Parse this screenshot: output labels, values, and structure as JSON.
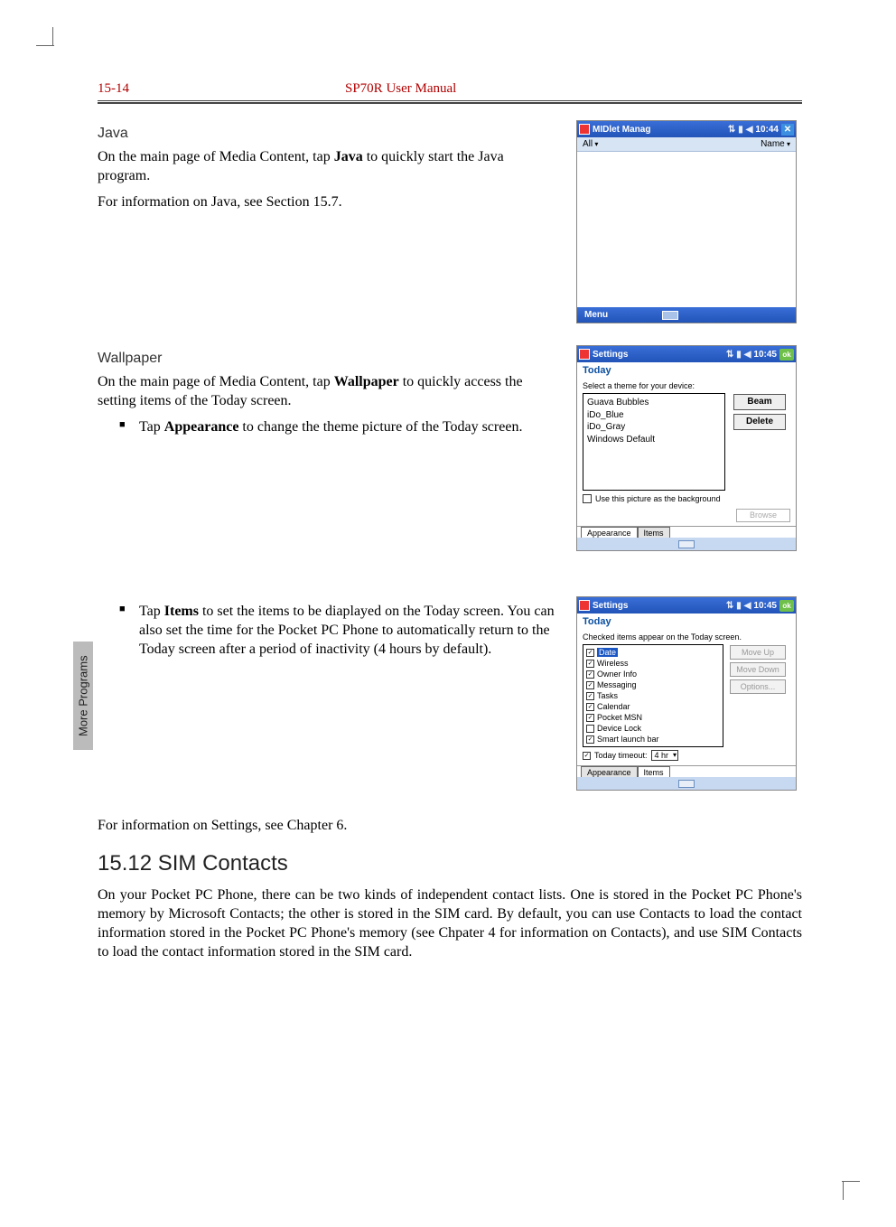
{
  "header": {
    "page_no": "15-14",
    "title": "SP70R User Manual"
  },
  "side_tab": "More Programs",
  "java": {
    "heading": "Java",
    "p1_a": "On the main page of Media Content, tap ",
    "p1_b": "Java",
    "p1_c": " to quickly start the Java program.",
    "p2": "For information on Java, see Section 15.7."
  },
  "wallpaper": {
    "heading": "Wallpaper",
    "p1_a": "On the main page of Media Content, tap ",
    "p1_b": "Wallpaper",
    "p1_c": " to quickly access the setting items of the Today screen.",
    "b1_a": "Tap ",
    "b1_b": "Appearance",
    "b1_c": " to change the theme picture of the Today screen.",
    "b2_a": "Tap ",
    "b2_b": "Items",
    "b2_c": " to set the items to be diaplayed on the Today screen. You can also set the time for the Pocket PC Phone to automatically return to the Today screen after a period of inactivity (4 hours by default).",
    "p2": "For information on Settings, see Chapter 6."
  },
  "sim": {
    "heading": "15.12  SIM Contacts",
    "p1": "On your Pocket PC Phone, there can be two kinds of independent contact lists. One is stored in the Pocket PC Phone's memory by Microsoft Contacts; the other is stored in the SIM card. By default, you can use Contacts to load the contact information stored in the Pocket PC Phone's memory (see Chpater 4 for information on Contacts), and use SIM Contacts to load the contact information stored in the SIM card."
  },
  "shot1": {
    "title": "MIDlet Manag",
    "time": "10:44",
    "all": "All",
    "name": "Name",
    "menu": "Menu"
  },
  "shot2": {
    "title": "Settings",
    "time": "10:45",
    "ok": "ok",
    "today": "Today",
    "hint": "Select a theme for your device:",
    "themes": [
      "Guava Bubbles",
      "iDo_Blue",
      "iDo_Gray",
      "Windows Default"
    ],
    "beam": "Beam",
    "delete": "Delete",
    "usebg": "Use this picture as the background",
    "browse": "Browse",
    "tab1": "Appearance",
    "tab2": "Items"
  },
  "shot3": {
    "title": "Settings",
    "time": "10:45",
    "ok": "ok",
    "today": "Today",
    "hint": "Checked items appear on the Today screen.",
    "items": [
      {
        "label": "Date",
        "checked": true,
        "hl": true
      },
      {
        "label": "Wireless",
        "checked": true
      },
      {
        "label": "Owner Info",
        "checked": true
      },
      {
        "label": "Messaging",
        "checked": true
      },
      {
        "label": "Tasks",
        "checked": true
      },
      {
        "label": "Calendar",
        "checked": true
      },
      {
        "label": "Pocket MSN",
        "checked": true
      },
      {
        "label": "Device Lock",
        "checked": false
      },
      {
        "label": "Smart launch bar",
        "checked": true
      }
    ],
    "moveup": "Move Up",
    "movedown": "Move Down",
    "options": "Options...",
    "timeout_label": "Today timeout:",
    "timeout_val": "4 hr",
    "tab1": "Appearance",
    "tab2": "Items"
  }
}
